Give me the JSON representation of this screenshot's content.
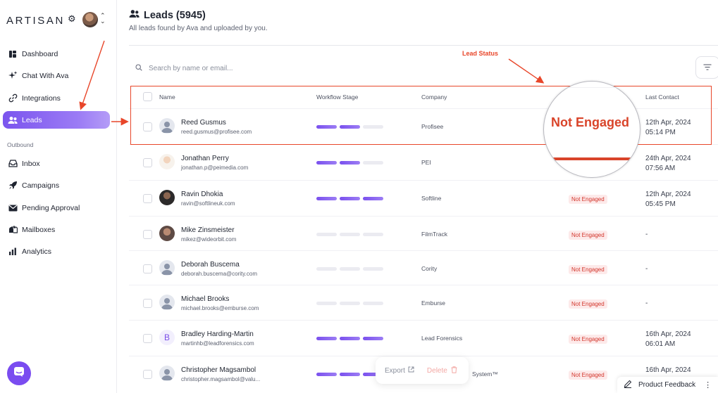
{
  "app": {
    "brand": "ARTISAN"
  },
  "sidebar": {
    "items": [
      {
        "label": "Dashboard",
        "icon": "dashboard-icon"
      },
      {
        "label": "Chat With Ava",
        "icon": "sparkle-icon"
      },
      {
        "label": "Integrations",
        "icon": "link-icon"
      },
      {
        "label": "Leads",
        "icon": "users-icon",
        "active": true
      }
    ],
    "outbound_label": "Outbound",
    "outbound_items": [
      {
        "label": "Inbox",
        "icon": "inbox-icon"
      },
      {
        "label": "Campaigns",
        "icon": "rocket-icon"
      },
      {
        "label": "Pending Approval",
        "icon": "mail-icon"
      },
      {
        "label": "Mailboxes",
        "icon": "mailbox-icon"
      },
      {
        "label": "Analytics",
        "icon": "bar-chart-icon"
      }
    ]
  },
  "header": {
    "title": "Leads (5945)",
    "subtitle": "All leads found by Ava and uploaded by you."
  },
  "search": {
    "placeholder": "Search by name or email..."
  },
  "table": {
    "columns": {
      "name": "Name",
      "stage": "Workflow Stage",
      "company": "Company",
      "last_contact": "Last Contact"
    },
    "rows": [
      {
        "name": "Reed Gusmus",
        "email": "reed.gusmus@profisee.com",
        "company": "Profisee",
        "stage": 2,
        "status": "",
        "last_contact_date": "12th Apr, 2024",
        "last_contact_time": "05:14 PM",
        "avatar": "default"
      },
      {
        "name": "Jonathan Perry",
        "email": "jonathan.p@peimedia.com",
        "company": "PEI",
        "stage": 2,
        "status": "",
        "last_contact_date": "24th Apr, 2024",
        "last_contact_time": "07:56 AM",
        "avatar": "photo1"
      },
      {
        "name": "Ravin Dhokia",
        "email": "ravin@softlineuk.com",
        "company": "Softline",
        "stage": 3,
        "status": "Not Engaged",
        "last_contact_date": "12th Apr, 2024",
        "last_contact_time": "05:45 PM",
        "avatar": "photo2"
      },
      {
        "name": "Mike Zinsmeister",
        "email": "mikez@wideorbit.com",
        "company": "FilmTrack",
        "stage": 0,
        "status": "Not Engaged",
        "last_contact_date": "-",
        "last_contact_time": "",
        "avatar": "photo3"
      },
      {
        "name": "Deborah Buscema",
        "email": "deborah.buscema@cority.com",
        "company": "Cority",
        "stage": 0,
        "status": "Not Engaged",
        "last_contact_date": "-",
        "last_contact_time": "",
        "avatar": "default"
      },
      {
        "name": "Michael Brooks",
        "email": "michael.brooks@emburse.com",
        "company": "Emburse",
        "stage": 0,
        "status": "Not Engaged",
        "last_contact_date": "-",
        "last_contact_time": "",
        "avatar": "default"
      },
      {
        "name": "Bradley Harding-Martin",
        "email": "martinhb@leadforensics.com",
        "company": "Lead Forensics",
        "stage": 3,
        "status": "Not Engaged",
        "last_contact_date": "16th Apr, 2024",
        "last_contact_time": "06:01 AM",
        "avatar": "letter",
        "avatar_letter": "B"
      },
      {
        "name": "Christopher Magsambol",
        "email": "christopher.magsambol@valu...",
        "company": "System™",
        "stage": 3,
        "status": "Not Engaged",
        "last_contact_date": "16th Apr, 2024",
        "last_contact_time": "",
        "avatar": "default"
      }
    ]
  },
  "annotations": {
    "lead_status_label": "Lead Status",
    "magnified_status": "Not Engaged",
    "color": "#e8462a"
  },
  "bulk_actions": {
    "export_label": "Export",
    "delete_label": "Delete"
  },
  "feedback": {
    "label": "Product Feedback"
  },
  "colors": {
    "accent": "#7b55ee",
    "danger": "#e8462a"
  }
}
